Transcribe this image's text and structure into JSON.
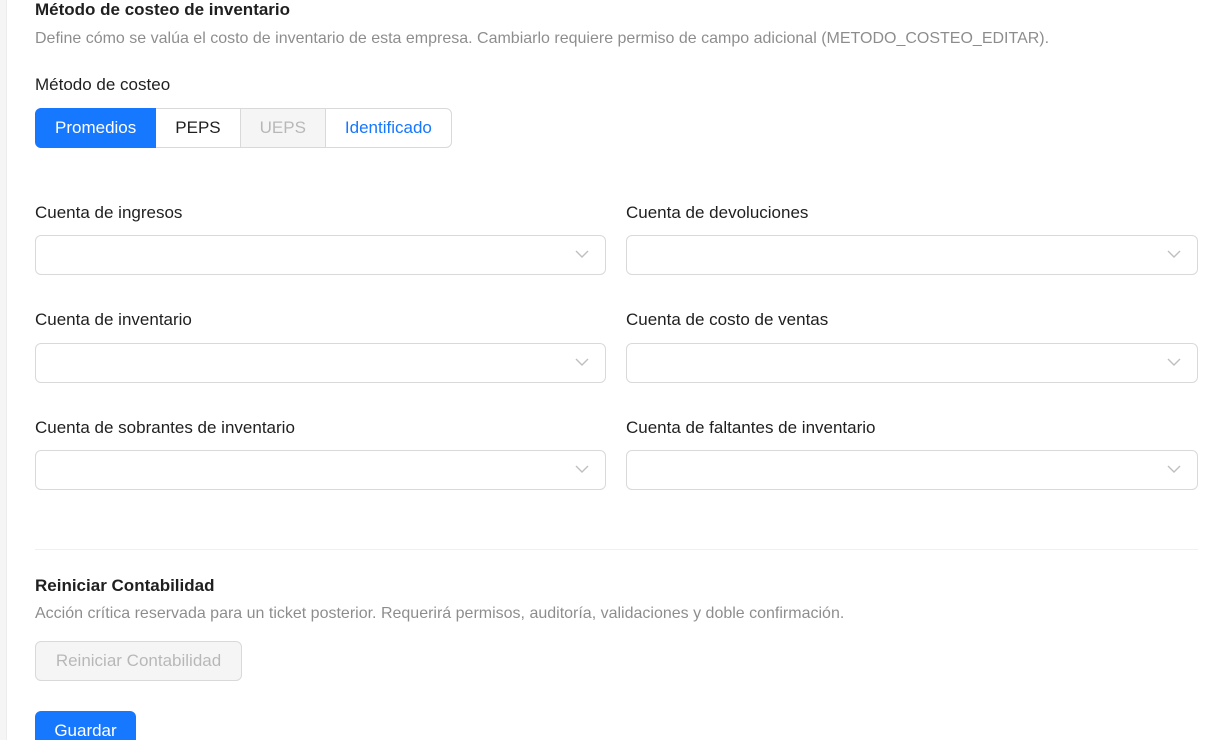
{
  "costing": {
    "title": "Método de costeo de inventario",
    "description": "Define cómo se valúa el costo de inventario de esta empresa. Cambiarlo requiere permiso de campo adicional (METODO_COSTEO_EDITAR).",
    "method_label": "Método de costeo",
    "options": [
      {
        "label": "Promedios",
        "state": "selected"
      },
      {
        "label": "PEPS",
        "state": "default"
      },
      {
        "label": "UEPS",
        "state": "disabled"
      },
      {
        "label": "Identificado",
        "state": "link"
      }
    ]
  },
  "accounts": {
    "ingresos_label": "Cuenta de ingresos",
    "devoluciones_label": "Cuenta de devoluciones",
    "inventario_label": "Cuenta de inventario",
    "costo_ventas_label": "Cuenta de costo de ventas",
    "sobrantes_label": "Cuenta de sobrantes de inventario",
    "faltantes_label": "Cuenta de faltantes de inventario"
  },
  "reset": {
    "title": "Reiniciar Contabilidad",
    "description": "Acción crítica reservada para un ticket posterior. Requerirá permisos, auditoría, validaciones y doble confirmación.",
    "button_label": "Reiniciar Contabilidad"
  },
  "actions": {
    "save_label": "Guardar"
  },
  "colors": {
    "primary": "#1677ff",
    "border": "#d9d9d9",
    "disabled_bg": "#f5f5f5",
    "muted_text": "#8c8c8c"
  }
}
